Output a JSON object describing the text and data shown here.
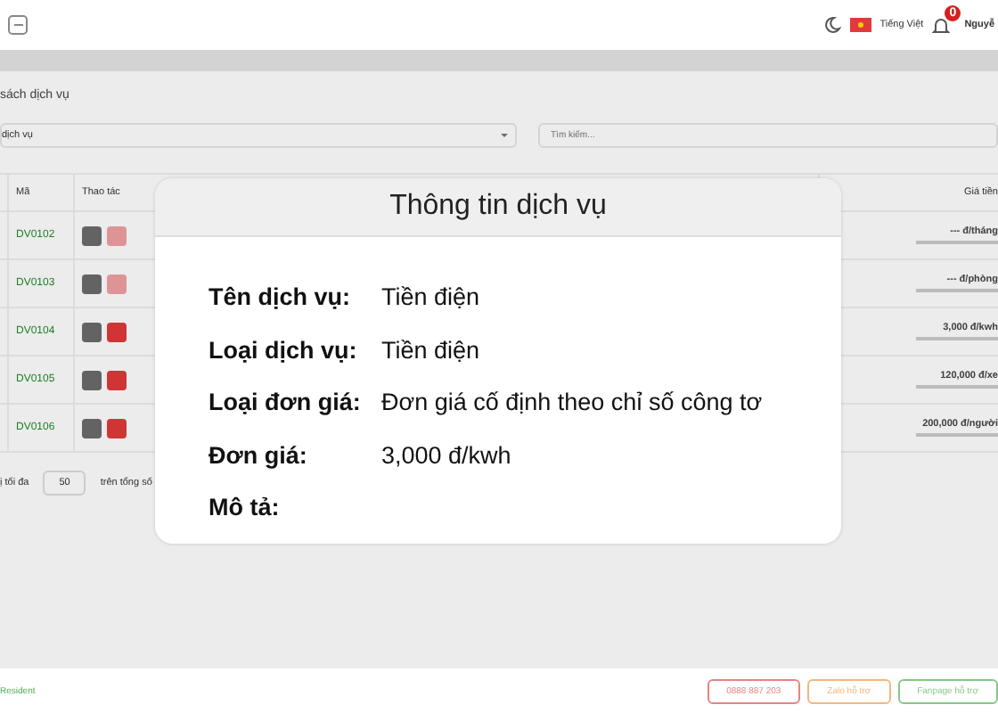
{
  "topbar": {
    "language": "Tiếng Việt",
    "notification_count": "0",
    "user": "Nguyễ"
  },
  "page": {
    "title": "sách dịch vụ",
    "filter": {
      "value": "dịch vụ"
    },
    "search": {
      "placeholder": "Tìm kiếm..."
    },
    "table": {
      "columns": [
        "Mã",
        "Thao tác",
        "Giá tiền"
      ],
      "rows": [
        {
          "code": "DV0102",
          "price": "--- đ/tháng",
          "delete_enabled": false
        },
        {
          "code": "DV0103",
          "price": "--- đ/phòng",
          "delete_enabled": false
        },
        {
          "code": "DV0104",
          "price": "3,000 đ/kwh",
          "delete_enabled": true
        },
        {
          "code": "DV0105",
          "price": "120,000 đ/xe",
          "delete_enabled": true
        },
        {
          "code": "DV0106",
          "price": "200,000 đ/người",
          "delete_enabled": true
        }
      ]
    },
    "pagination": {
      "label": "ị tối đa",
      "page_size": "50",
      "total": "trên tổng số"
    }
  },
  "footer": {
    "brand": "Resident",
    "buttons": [
      {
        "kind": "phone",
        "label": "0888 887 203"
      },
      {
        "kind": "zalo",
        "label": "Zalo hỗ trợ"
      },
      {
        "kind": "fanpage",
        "label": "Fanpage hỗ trợ"
      }
    ]
  },
  "modal": {
    "title": "Thông tin dịch vụ",
    "fields": [
      {
        "label": "Tên dịch vụ:",
        "value": "Tiền điện"
      },
      {
        "label": "Loại dịch vụ:",
        "value": "Tiền điện"
      },
      {
        "label": "Loại đơn giá:",
        "value": "Đơn giá cố định theo chỉ số công tơ"
      },
      {
        "label": "Đơn giá:",
        "value": "3,000 đ/kwh"
      },
      {
        "label": "Mô tả:"
      }
    ]
  }
}
